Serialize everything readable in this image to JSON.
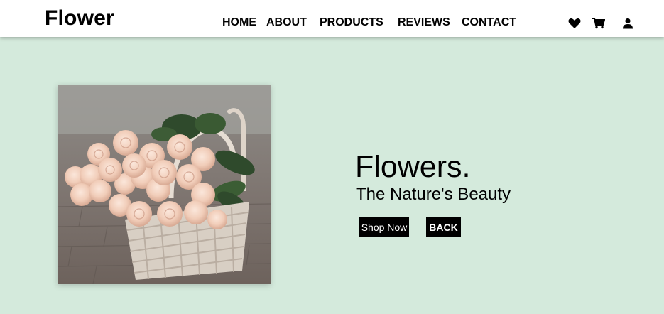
{
  "brand": {
    "name": "Flower"
  },
  "nav": {
    "items": [
      {
        "label": "HOME"
      },
      {
        "label": "ABOUT"
      },
      {
        "label": "PRODUCTS"
      },
      {
        "label": "REVIEWS"
      },
      {
        "label": "CONTACT"
      }
    ],
    "icons": [
      "heart-icon",
      "cart-icon",
      "user-icon"
    ]
  },
  "hero": {
    "title": "Flowers.",
    "subtitle": "The Nature's Beauty",
    "shop_button": "Shop Now",
    "back_button": "BACK",
    "image": "rose-basket-photo"
  },
  "colors": {
    "background": "#d4eadc",
    "navbar": "#ffffff",
    "button": "#000000",
    "button_text": "#ffffff"
  }
}
